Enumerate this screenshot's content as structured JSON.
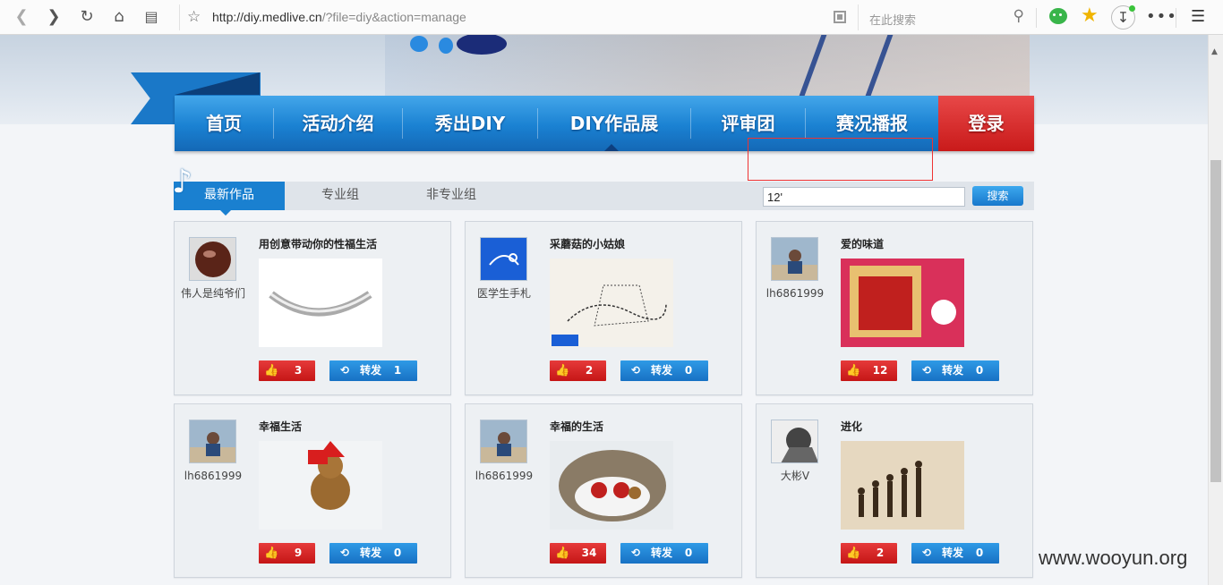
{
  "browser": {
    "url_host": "http://diy.medlive.cn",
    "url_path": "/?file=diy&action=manage",
    "search_placeholder": "在此搜索"
  },
  "nav": {
    "items": [
      "首页",
      "活动介绍",
      "秀出DIY",
      "DIY作品展",
      "评审团",
      "赛况播报"
    ],
    "login": "登录",
    "active_index": 3
  },
  "tabs": {
    "items": [
      "最新作品",
      "专业组",
      "非专业组"
    ],
    "active_index": 0
  },
  "search": {
    "value": "12'",
    "button": "搜索"
  },
  "share_label": "转发",
  "cards": [
    {
      "user": "伟人是纯爷们",
      "title": "用创意带动你的性福生活",
      "likes": "3",
      "shares": "1"
    },
    {
      "user": "医学生手札",
      "title": "采蘑菇的小姑娘",
      "likes": "2",
      "shares": "0"
    },
    {
      "user": "lh6861999",
      "title": "爱的味道",
      "likes": "12",
      "shares": "0"
    },
    {
      "user": "lh6861999",
      "title": "幸福生活",
      "likes": "9",
      "shares": "0"
    },
    {
      "user": "lh6861999",
      "title": "幸福的生活",
      "likes": "34",
      "shares": "0"
    },
    {
      "user": "大彬V",
      "title": "进化",
      "likes": "2",
      "shares": "0"
    }
  ],
  "watermark": "www.wooyun.org",
  "colors": {
    "nav_blue": "#1a81d2",
    "login_red": "#c91a1a",
    "like_red": "#d62424",
    "share_blue": "#1f84d6"
  }
}
